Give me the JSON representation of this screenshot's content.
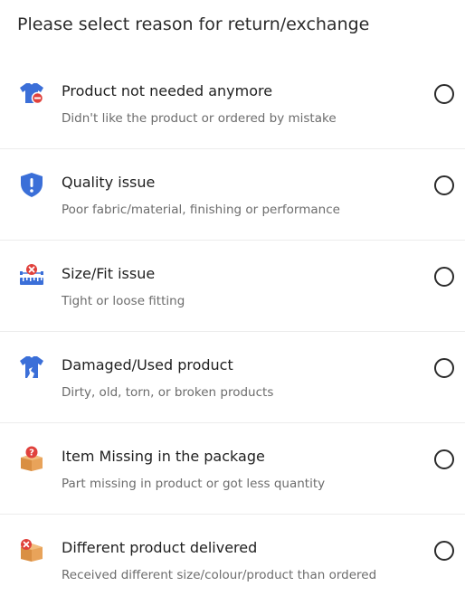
{
  "page": {
    "title": "Please select reason for return/exchange"
  },
  "options": [
    {
      "icon": "tshirt-minus-icon",
      "title": "Product not needed anymore",
      "subtitle": "Didn't like the product or ordered by mistake"
    },
    {
      "icon": "shield-exclamation-icon",
      "title": "Quality issue",
      "subtitle": "Poor fabric/material, finishing or performance"
    },
    {
      "icon": "measuring-tape-icon",
      "title": "Size/Fit issue",
      "subtitle": "Tight or loose fitting"
    },
    {
      "icon": "torn-tshirt-icon",
      "title": "Damaged/Used product",
      "subtitle": "Dirty, old, torn, or broken products"
    },
    {
      "icon": "package-question-icon",
      "title": "Item Missing in the package",
      "subtitle": "Part missing in product or got less quantity"
    },
    {
      "icon": "package-wrong-icon",
      "title": "Different product delivered",
      "subtitle": "Received different size/colour/product than ordered"
    }
  ],
  "colors": {
    "blue": "#3b6fd8",
    "red": "#e0413c",
    "box": "#e8a35a"
  }
}
